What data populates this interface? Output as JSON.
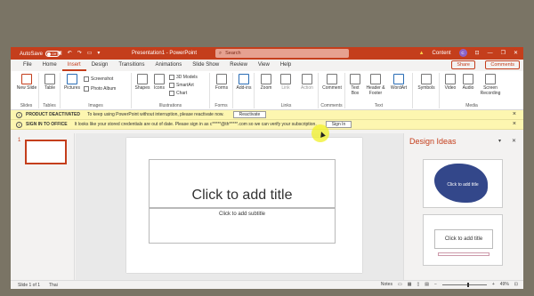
{
  "titlebar": {
    "autosave_label": "AutoSave",
    "autosave_state": "Off",
    "document_title": "Presentation1 - PowerPoint",
    "search_placeholder": "Search",
    "account_name": "Content",
    "avatar_initials": "C"
  },
  "tabs": [
    "File",
    "Home",
    "Insert",
    "Design",
    "Transitions",
    "Animations",
    "Slide Show",
    "Review",
    "View",
    "Help"
  ],
  "active_tab": "Insert",
  "share_label": "Share",
  "comments_label": "Comments",
  "ribbon": {
    "slides": {
      "label": "Slides",
      "new_slide": "New Slide"
    },
    "tables": {
      "label": "Tables",
      "table": "Table"
    },
    "images": {
      "label": "Images",
      "pictures": "Pictures",
      "screenshot": "Screenshot",
      "photo_album": "Photo Album"
    },
    "illustrations": {
      "label": "Illustrations",
      "shapes": "Shapes",
      "icons": "Icons",
      "models": "3D Models",
      "smartart": "SmartArt",
      "chart": "Chart"
    },
    "forms": {
      "label": "Forms",
      "forms": "Forms"
    },
    "addins": {
      "label": "",
      "addins": "Add-ins"
    },
    "links": {
      "label": "Links",
      "zoom": "Zoom",
      "link": "Link",
      "action": "Action"
    },
    "comments": {
      "label": "Comments",
      "comment": "Comment"
    },
    "text": {
      "label": "Text",
      "textbox": "Text Box",
      "header_footer": "Header & Footer",
      "wordart": "WordArt"
    },
    "symbols": {
      "label": "",
      "symbols": "Symbols"
    },
    "media": {
      "label": "Media",
      "video": "Video",
      "audio": "Audio",
      "screen_recording": "Screen Recording"
    }
  },
  "bars": {
    "deactivated": {
      "title": "PRODUCT DEACTIVATED",
      "message": "To keep using PowerPoint without interruption, please reactivate now.",
      "button": "Reactivate"
    },
    "signin": {
      "title": "SIGN IN TO OFFICE",
      "message": "It looks like your stored credentials are out of date. Please sign in as c*****@th*****.com so we can verify your subscription.",
      "button": "Sign In"
    }
  },
  "slide_panel": {
    "number": "1"
  },
  "slide": {
    "title_placeholder": "Click to add title",
    "subtitle_placeholder": "Click to add subtitle"
  },
  "design_ideas": {
    "title": "Design Ideas",
    "card1_text": "Click to add title",
    "card2_text": "Click to add title"
  },
  "statusbar": {
    "slide_info": "Slide 1 of 1",
    "language": "Thai",
    "notes": "Notes",
    "zoom": "49%"
  }
}
